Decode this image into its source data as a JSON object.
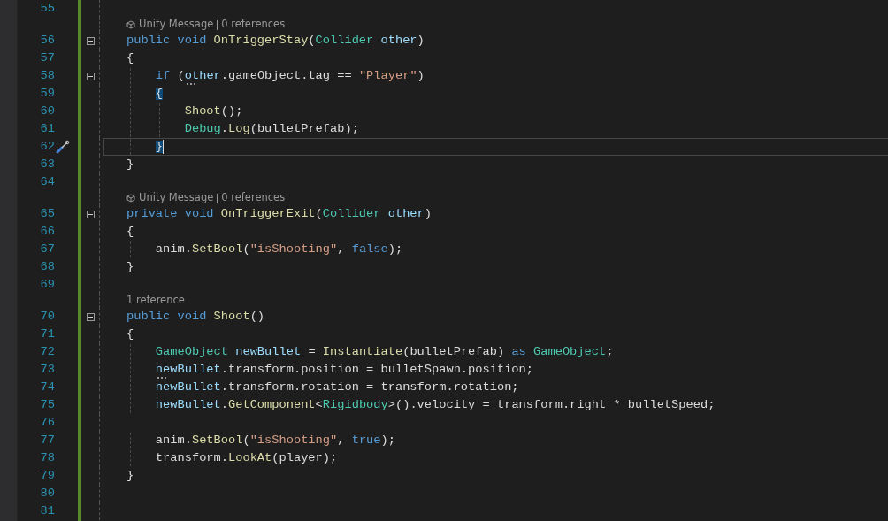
{
  "lines": [
    {
      "number": "55",
      "current": false
    },
    {
      "number": "56",
      "current": false,
      "collapsible": true,
      "codelens": [
        {
          "kind": "message",
          "text": "Unity Message"
        },
        {
          "kind": "references",
          "text": "0 references"
        }
      ],
      "tokens": [
        {
          "kind": "keyword",
          "text": "public void "
        },
        {
          "kind": "method",
          "text": "OnTriggerStay"
        },
        {
          "kind": "plain",
          "text": "("
        },
        {
          "kind": "type",
          "text": "Collider"
        },
        {
          "kind": "param",
          "text": " other"
        },
        {
          "kind": "plain",
          "text": ")"
        }
      ]
    },
    {
      "number": "57",
      "current": false,
      "tokens": [
        {
          "kind": "plain",
          "text": "{"
        }
      ]
    },
    {
      "number": "58",
      "current": false,
      "collapsible": true,
      "tokens": [
        {
          "kind": "keyword",
          "text": "    if "
        },
        {
          "kind": "plain",
          "text": "("
        },
        {
          "kind": "param",
          "text": "other",
          "hint": true
        },
        {
          "kind": "plain",
          "text": ".gameObject.tag == "
        },
        {
          "kind": "string",
          "text": "\"Player\""
        },
        {
          "kind": "plain",
          "text": ")"
        }
      ]
    },
    {
      "number": "59",
      "current": false,
      "tokens": [
        {
          "kind": "plain",
          "text": "    {",
          "matched": true
        }
      ]
    },
    {
      "number": "60",
      "current": false,
      "tokens": [
        {
          "kind": "method",
          "text": "        Shoot"
        },
        {
          "kind": "plain",
          "text": "();"
        }
      ]
    },
    {
      "number": "61",
      "current": false,
      "tokens": [
        {
          "kind": "type",
          "text": "        Debug"
        },
        {
          "kind": "plain",
          "text": "."
        },
        {
          "kind": "method",
          "text": "Log"
        },
        {
          "kind": "plain",
          "text": "(bulletPrefab);"
        }
      ]
    },
    {
      "number": "62",
      "current": true,
      "quick_actions": true,
      "tokens": [
        {
          "kind": "plain",
          "text": "    }",
          "matched": true
        }
      ]
    },
    {
      "number": "63",
      "current": false,
      "tokens": [
        {
          "kind": "plain",
          "text": "}"
        }
      ]
    },
    {
      "number": "64",
      "current": false
    },
    {
      "number": "65",
      "current": false,
      "collapsible": true,
      "codelens": [
        {
          "kind": "message",
          "text": "Unity Message"
        },
        {
          "kind": "references",
          "text": "0 references"
        }
      ],
      "tokens": [
        {
          "kind": "keyword",
          "text": "private void "
        },
        {
          "kind": "method",
          "text": "OnTriggerExit"
        },
        {
          "kind": "plain",
          "text": "("
        },
        {
          "kind": "type",
          "text": "Collider"
        },
        {
          "kind": "param",
          "text": " other"
        },
        {
          "kind": "plain",
          "text": ")"
        }
      ]
    },
    {
      "number": "66",
      "current": false,
      "tokens": [
        {
          "kind": "plain",
          "text": "{"
        }
      ]
    },
    {
      "number": "67",
      "current": false,
      "tokens": [
        {
          "kind": "plain",
          "text": "    anim."
        },
        {
          "kind": "method",
          "text": "SetBool"
        },
        {
          "kind": "plain",
          "text": "("
        },
        {
          "kind": "string",
          "text": "\"isShooting\""
        },
        {
          "kind": "plain",
          "text": ", "
        },
        {
          "kind": "keyword",
          "text": "false"
        },
        {
          "kind": "plain",
          "text": ");"
        }
      ]
    },
    {
      "number": "68",
      "current": false,
      "tokens": [
        {
          "kind": "plain",
          "text": "}"
        }
      ]
    },
    {
      "number": "69",
      "current": false
    },
    {
      "number": "70",
      "current": false,
      "collapsible": true,
      "codelens": [
        {
          "kind": "references",
          "text": "1 reference"
        }
      ],
      "tokens": [
        {
          "kind": "keyword",
          "text": "public void "
        },
        {
          "kind": "method",
          "text": "Shoot"
        },
        {
          "kind": "plain",
          "text": "()"
        }
      ]
    },
    {
      "number": "71",
      "current": false,
      "tokens": [
        {
          "kind": "plain",
          "text": "{"
        }
      ]
    },
    {
      "number": "72",
      "current": false,
      "tokens": [
        {
          "kind": "type",
          "text": "    GameObject"
        },
        {
          "kind": "param",
          "text": " newBullet"
        },
        {
          "kind": "plain",
          "text": " = "
        },
        {
          "kind": "method",
          "text": "Instantiate"
        },
        {
          "kind": "plain",
          "text": "(bulletPrefab) "
        },
        {
          "kind": "keyword",
          "text": "as "
        },
        {
          "kind": "type",
          "text": "GameObject"
        },
        {
          "kind": "plain",
          "text": ";"
        }
      ]
    },
    {
      "number": "73",
      "current": false,
      "tokens": [
        {
          "kind": "param",
          "text": "    newBullet",
          "hint": true
        },
        {
          "kind": "plain",
          "text": ".transform.position = bulletSpawn.position;"
        }
      ]
    },
    {
      "number": "74",
      "current": false,
      "tokens": [
        {
          "kind": "param",
          "text": "    newBullet"
        },
        {
          "kind": "plain",
          "text": ".transform.rotation = transform.rotation;"
        }
      ]
    },
    {
      "number": "75",
      "current": false,
      "tokens": [
        {
          "kind": "param",
          "text": "    newBullet"
        },
        {
          "kind": "plain",
          "text": "."
        },
        {
          "kind": "method",
          "text": "GetComponent"
        },
        {
          "kind": "plain",
          "text": "<"
        },
        {
          "kind": "type",
          "text": "Rigidbody"
        },
        {
          "kind": "plain",
          "text": ">().velocity = transform.right * bulletSpeed;"
        }
      ]
    },
    {
      "number": "76",
      "current": false
    },
    {
      "number": "77",
      "current": false,
      "tokens": [
        {
          "kind": "plain",
          "text": "    anim."
        },
        {
          "kind": "method",
          "text": "SetBool"
        },
        {
          "kind": "plain",
          "text": "("
        },
        {
          "kind": "string",
          "text": "\"isShooting\""
        },
        {
          "kind": "plain",
          "text": ", "
        },
        {
          "kind": "keyword",
          "text": "true"
        },
        {
          "kind": "plain",
          "text": ");"
        }
      ]
    },
    {
      "number": "78",
      "current": false,
      "tokens": [
        {
          "kind": "plain",
          "text": "    transform."
        },
        {
          "kind": "method",
          "text": "LookAt"
        },
        {
          "kind": "plain",
          "text": "(player);"
        }
      ]
    },
    {
      "number": "79",
      "current": false,
      "tokens": [
        {
          "kind": "plain",
          "text": "}"
        }
      ]
    },
    {
      "number": "80",
      "current": false
    },
    {
      "number": "81",
      "current": false
    }
  ]
}
